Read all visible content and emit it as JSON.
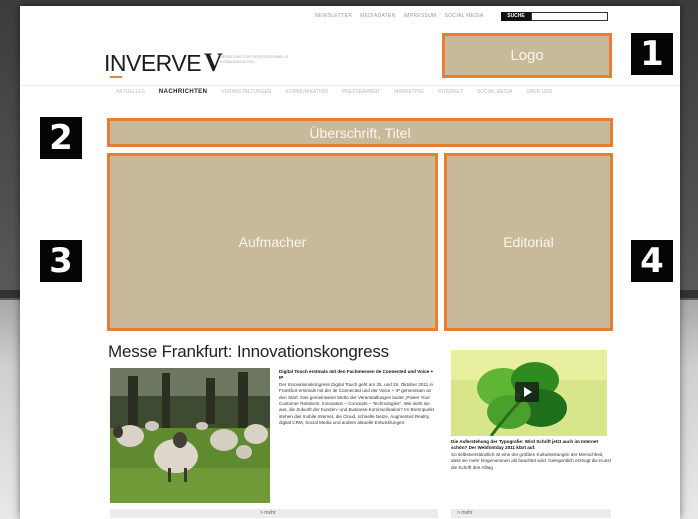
{
  "utility_links": [
    "NEWSLETTER",
    "MEDIADATEN",
    "IMPRESSUM",
    "SOCIAL MEDIA"
  ],
  "search": {
    "button_label": "SUCHE",
    "placeholder": ""
  },
  "brand": {
    "name": "INVERVE",
    "mark": "V",
    "tagline": "BERATUNG FÜR PROFESSIONELLE KOMMUNIKATION"
  },
  "nav": {
    "items": [
      "AKTUELLES",
      "NACHRICHTEN",
      "VERANSTALTUNGEN",
      "KOMMUNIKATION",
      "PRESSEARBEIT",
      "MARKETING",
      "INTERNET",
      "SOCIAL MEDIA",
      "ÜBER UNS"
    ],
    "active": "NACHRICHTEN"
  },
  "overlay": {
    "logo_label": "Logo",
    "title_label": "Überschrift, Titel",
    "aufmacher_label": "Aufmacher",
    "editorial_label": "Editorial",
    "markers": [
      "1",
      "2",
      "3",
      "4"
    ]
  },
  "article": {
    "headline": "Messe Frankfurt: Innovationskongress",
    "lead": "Digital Touch erstmals mit den Fachmessen de Connected und Voice + IP",
    "body": "Der Innovationskongress Digital Touch geht am 25. und 26. Oktober 2011 in Frankfurt erstmals mit der ite Connected und der Voice + IP gemeinsam an den Start. Das gemeinsame Motto der Veranstaltungen lautet „Power Your Customer Relations: Innovation – Concepts – Technologies\". Wie sieht sie aus, die Zukunft der Kunden- und Business-Kommunikation? Im Brennpunkt stehen das mobile Internet, die Cloud, schnelle Netze, Augmented Reality, digital CRM, Social Media und andere aktuelle Entwicklungen.",
    "more_label": "> mehr"
  },
  "sidebar": {
    "lead": "Die Auferstehung der Typografie: Wird Schrift jetzt auch im Internet schön? Der Webfontday 2011 klärt auf.",
    "body": "So selbstverständlich ist eine der größten Kulturleistungen der Menschheit, dass sie mehr hingenommen als beachtet wird. Gelegentlich erzeugt die Kunst die Schrift den Alltag",
    "more_label": "> mehr"
  },
  "colors": {
    "overlay_fill": "#c8b99a",
    "overlay_border": "#ea7d36",
    "marker": "#050505"
  }
}
